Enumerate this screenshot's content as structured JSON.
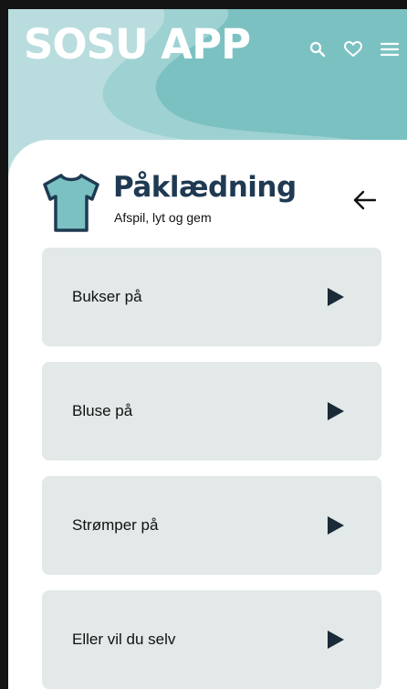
{
  "app": {
    "title": "SOSU APP",
    "accent_color": "#7cc1c2",
    "heading_color": "#1f3a52",
    "tile_color": "#e2e9e8"
  },
  "header_icons": [
    {
      "name": "search-icon"
    },
    {
      "name": "heart-icon"
    },
    {
      "name": "menu-icon"
    }
  ],
  "section": {
    "icon": "shirt-icon",
    "title": "Påklædning",
    "subtitle": "Afspil, lyt og gem",
    "back_icon": "arrow-left-icon"
  },
  "items": [
    {
      "label": "Bukser på",
      "icon": "play-icon"
    },
    {
      "label": "Bluse på",
      "icon": "play-icon"
    },
    {
      "label": "Strømper på",
      "icon": "play-icon"
    },
    {
      "label": "Eller vil du selv",
      "icon": "play-icon"
    }
  ]
}
